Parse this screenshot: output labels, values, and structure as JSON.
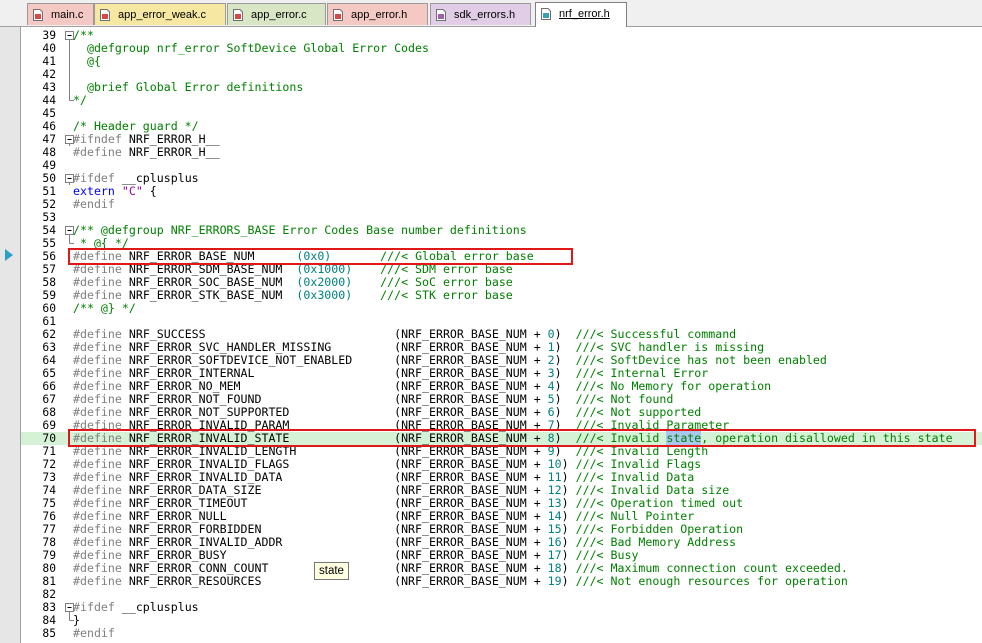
{
  "tabs": [
    {
      "label": "main.c",
      "color": "#f4c9c4",
      "icon": "c-file-icon",
      "icon_color": "#d84848"
    },
    {
      "label": "app_error_weak.c",
      "color": "#f6e7a2",
      "icon": "c-file-gear-icon",
      "icon_color": "#d84848"
    },
    {
      "label": "app_error.c",
      "color": "#d8e6c6",
      "icon": "c-file-gear-icon",
      "icon_color": "#d84848"
    },
    {
      "label": "app_error.h",
      "color": "#f4c9c4",
      "icon": "h-file-icon",
      "icon_color": "#d84848"
    },
    {
      "label": "sdk_errors.h",
      "color": "#e1cde6",
      "icon": "h-file-icon",
      "icon_color": "#a060b0"
    },
    {
      "label": "nrf_error.h",
      "color": "#ffffff",
      "icon": "h-file-icon",
      "icon_color": "#3aa0b8",
      "active": true
    }
  ],
  "tooltip": "state",
  "colors": {
    "comment": "#008000",
    "preprocessor": "#808080",
    "keyword": "#0000ff",
    "number": "#008080",
    "string": "#a000a0",
    "highlight_box": "#e01818"
  },
  "lines": [
    {
      "n": "39",
      "fold": "minus",
      "parts": [
        {
          "t": "/**",
          "c": "c"
        }
      ]
    },
    {
      "n": "40",
      "fold": "bar",
      "parts": [
        {
          "t": "  @defgroup nrf_error SoftDevice Global Error Codes",
          "c": "c"
        }
      ]
    },
    {
      "n": "41",
      "fold": "bar",
      "parts": [
        {
          "t": "  @{",
          "c": "c"
        }
      ]
    },
    {
      "n": "42",
      "fold": "bar",
      "parts": []
    },
    {
      "n": "43",
      "fold": "bar",
      "parts": [
        {
          "t": "  @brief Global Error definitions",
          "c": "c"
        }
      ]
    },
    {
      "n": "44",
      "fold": "end",
      "parts": [
        {
          "t": "*/",
          "c": "c"
        }
      ]
    },
    {
      "n": "45",
      "parts": []
    },
    {
      "n": "46",
      "parts": [
        {
          "t": "/* Header guard */",
          "c": "c"
        }
      ]
    },
    {
      "n": "47",
      "fold": "minus",
      "parts": [
        {
          "t": "#ifndef",
          "c": "p"
        },
        {
          "t": " NRF_ERROR_H__",
          "c": ""
        }
      ]
    },
    {
      "n": "48",
      "parts": [
        {
          "t": "#define",
          "c": "p"
        },
        {
          "t": " NRF_ERROR_H__",
          "c": ""
        }
      ]
    },
    {
      "n": "49",
      "parts": []
    },
    {
      "n": "50",
      "fold": "minus",
      "parts": [
        {
          "t": "#ifdef",
          "c": "p"
        },
        {
          "t": " __cplusplus",
          "c": ""
        }
      ]
    },
    {
      "n": "51",
      "parts": [
        {
          "t": "extern",
          "c": "kw"
        },
        {
          "t": " ",
          "c": ""
        },
        {
          "t": "\"C\"",
          "c": "s"
        },
        {
          "t": " {",
          "c": ""
        }
      ]
    },
    {
      "n": "52",
      "parts": [
        {
          "t": "#endif",
          "c": "p"
        }
      ]
    },
    {
      "n": "53",
      "parts": []
    },
    {
      "n": "54",
      "fold": "minus",
      "parts": [
        {
          "t": "/** @defgroup NRF_ERRORS_BASE Error Codes Base number definitions",
          "c": "c"
        }
      ]
    },
    {
      "n": "55",
      "fold": "end",
      "parts": [
        {
          "t": " * @{ */",
          "c": "c"
        }
      ]
    },
    {
      "n": "56",
      "parts": [
        {
          "t": "#define",
          "c": "p"
        },
        {
          "t": " NRF_ERROR_BASE_NUM      ",
          "c": ""
        },
        {
          "t": "(0x0)",
          "c": "n"
        },
        {
          "t": "       ",
          "c": ""
        },
        {
          "t": "///< Global error base",
          "c": "c"
        }
      ]
    },
    {
      "n": "57",
      "parts": [
        {
          "t": "#define",
          "c": "p"
        },
        {
          "t": " NRF_ERROR_SDM_BASE_NUM  ",
          "c": ""
        },
        {
          "t": "(0x1000)",
          "c": "n"
        },
        {
          "t": "    ",
          "c": ""
        },
        {
          "t": "///< SDM error base",
          "c": "c"
        }
      ]
    },
    {
      "n": "58",
      "parts": [
        {
          "t": "#define",
          "c": "p"
        },
        {
          "t": " NRF_ERROR_SOC_BASE_NUM  ",
          "c": ""
        },
        {
          "t": "(0x2000)",
          "c": "n"
        },
        {
          "t": "    ",
          "c": ""
        },
        {
          "t": "///< SoC error base",
          "c": "c"
        }
      ]
    },
    {
      "n": "59",
      "parts": [
        {
          "t": "#define",
          "c": "p"
        },
        {
          "t": " NRF_ERROR_STK_BASE_NUM  ",
          "c": ""
        },
        {
          "t": "(0x3000)",
          "c": "n"
        },
        {
          "t": "    ",
          "c": ""
        },
        {
          "t": "///< STK error base",
          "c": "c"
        }
      ]
    },
    {
      "n": "60",
      "parts": [
        {
          "t": "/** @} */",
          "c": "c"
        }
      ]
    },
    {
      "n": "61",
      "parts": []
    },
    {
      "n": "62",
      "parts": [
        {
          "t": "#define",
          "c": "p"
        },
        {
          "t": " NRF_SUCCESS                           (NRF_ERROR_BASE_NUM + ",
          "c": ""
        },
        {
          "t": "0",
          "c": "n"
        },
        {
          "t": ")  ",
          "c": ""
        },
        {
          "t": "///< Successful command",
          "c": "c"
        }
      ]
    },
    {
      "n": "63",
      "parts": [
        {
          "t": "#define",
          "c": "p"
        },
        {
          "t": " NRF_ERROR_SVC_HANDLER_MISSING         (NRF_ERROR_BASE_NUM + ",
          "c": ""
        },
        {
          "t": "1",
          "c": "n"
        },
        {
          "t": ")  ",
          "c": ""
        },
        {
          "t": "///< SVC handler is missing",
          "c": "c"
        }
      ]
    },
    {
      "n": "64",
      "parts": [
        {
          "t": "#define",
          "c": "p"
        },
        {
          "t": " NRF_ERROR_SOFTDEVICE_NOT_ENABLED      (NRF_ERROR_BASE_NUM + ",
          "c": ""
        },
        {
          "t": "2",
          "c": "n"
        },
        {
          "t": ")  ",
          "c": ""
        },
        {
          "t": "///< SoftDevice has not been enabled",
          "c": "c"
        }
      ]
    },
    {
      "n": "65",
      "parts": [
        {
          "t": "#define",
          "c": "p"
        },
        {
          "t": " NRF_ERROR_INTERNAL                    (NRF_ERROR_BASE_NUM + ",
          "c": ""
        },
        {
          "t": "3",
          "c": "n"
        },
        {
          "t": ")  ",
          "c": ""
        },
        {
          "t": "///< Internal Error",
          "c": "c"
        }
      ]
    },
    {
      "n": "66",
      "parts": [
        {
          "t": "#define",
          "c": "p"
        },
        {
          "t": " NRF_ERROR_NO_MEM                      (NRF_ERROR_BASE_NUM + ",
          "c": ""
        },
        {
          "t": "4",
          "c": "n"
        },
        {
          "t": ")  ",
          "c": ""
        },
        {
          "t": "///< No Memory for operation",
          "c": "c"
        }
      ]
    },
    {
      "n": "67",
      "parts": [
        {
          "t": "#define",
          "c": "p"
        },
        {
          "t": " NRF_ERROR_NOT_FOUND                   (NRF_ERROR_BASE_NUM + ",
          "c": ""
        },
        {
          "t": "5",
          "c": "n"
        },
        {
          "t": ")  ",
          "c": ""
        },
        {
          "t": "///< Not found",
          "c": "c"
        }
      ]
    },
    {
      "n": "68",
      "parts": [
        {
          "t": "#define",
          "c": "p"
        },
        {
          "t": " NRF_ERROR_NOT_SUPPORTED               (NRF_ERROR_BASE_NUM + ",
          "c": ""
        },
        {
          "t": "6",
          "c": "n"
        },
        {
          "t": ")  ",
          "c": ""
        },
        {
          "t": "///< Not supported",
          "c": "c"
        }
      ]
    },
    {
      "n": "69",
      "parts": [
        {
          "t": "#define",
          "c": "p"
        },
        {
          "t": " NRF_ERROR_INVALID_PARAM               (NRF_ERROR_BASE_NUM + ",
          "c": ""
        },
        {
          "t": "7",
          "c": "n"
        },
        {
          "t": ")  ",
          "c": ""
        },
        {
          "t": "///< Invalid Parameter",
          "c": "c"
        }
      ]
    },
    {
      "n": "70",
      "hl": true,
      "parts": [
        {
          "t": "#define",
          "c": "p"
        },
        {
          "t": " NRF_ERROR_INVALID_STATE               (NRF_ERROR_BASE_NUM + ",
          "c": ""
        },
        {
          "t": "8",
          "c": "n"
        },
        {
          "t": ")  ",
          "c": ""
        },
        {
          "t": "///< Invalid ",
          "c": "c"
        },
        {
          "t": "state",
          "c": "c sel"
        },
        {
          "t": ", operation disallowed in this state",
          "c": "c"
        }
      ]
    },
    {
      "n": "71",
      "parts": [
        {
          "t": "#define",
          "c": "p"
        },
        {
          "t": " NRF_ERROR_INVALID_LENGTH              (NRF_ERROR_BASE_NUM + ",
          "c": ""
        },
        {
          "t": "9",
          "c": "n"
        },
        {
          "t": ")  ",
          "c": ""
        },
        {
          "t": "///< Invalid Length",
          "c": "c"
        }
      ]
    },
    {
      "n": "72",
      "parts": [
        {
          "t": "#define",
          "c": "p"
        },
        {
          "t": " NRF_ERROR_INVALID_FLAGS               (NRF_ERROR_BASE_NUM + ",
          "c": ""
        },
        {
          "t": "10",
          "c": "n"
        },
        {
          "t": ") ",
          "c": ""
        },
        {
          "t": "///< Invalid Flags",
          "c": "c"
        }
      ]
    },
    {
      "n": "73",
      "parts": [
        {
          "t": "#define",
          "c": "p"
        },
        {
          "t": " NRF_ERROR_INVALID_DATA                (NRF_ERROR_BASE_NUM + ",
          "c": ""
        },
        {
          "t": "11",
          "c": "n"
        },
        {
          "t": ") ",
          "c": ""
        },
        {
          "t": "///< Invalid Data",
          "c": "c"
        }
      ]
    },
    {
      "n": "74",
      "parts": [
        {
          "t": "#define",
          "c": "p"
        },
        {
          "t": " NRF_ERROR_DATA_SIZE                   (NRF_ERROR_BASE_NUM + ",
          "c": ""
        },
        {
          "t": "12",
          "c": "n"
        },
        {
          "t": ") ",
          "c": ""
        },
        {
          "t": "///< Invalid Data size",
          "c": "c"
        }
      ]
    },
    {
      "n": "75",
      "parts": [
        {
          "t": "#define",
          "c": "p"
        },
        {
          "t": " NRF_ERROR_TIMEOUT                     (NRF_ERROR_BASE_NUM + ",
          "c": ""
        },
        {
          "t": "13",
          "c": "n"
        },
        {
          "t": ") ",
          "c": ""
        },
        {
          "t": "///< Operation timed out",
          "c": "c"
        }
      ]
    },
    {
      "n": "76",
      "parts": [
        {
          "t": "#define",
          "c": "p"
        },
        {
          "t": " NRF_ERROR_NULL                        (NRF_ERROR_BASE_NUM + ",
          "c": ""
        },
        {
          "t": "14",
          "c": "n"
        },
        {
          "t": ") ",
          "c": ""
        },
        {
          "t": "///< Null Pointer",
          "c": "c"
        }
      ]
    },
    {
      "n": "77",
      "parts": [
        {
          "t": "#define",
          "c": "p"
        },
        {
          "t": " NRF_ERROR_FORBIDDEN                   (NRF_ERROR_BASE_NUM + ",
          "c": ""
        },
        {
          "t": "15",
          "c": "n"
        },
        {
          "t": ") ",
          "c": ""
        },
        {
          "t": "///< Forbidden Operation",
          "c": "c"
        }
      ]
    },
    {
      "n": "78",
      "parts": [
        {
          "t": "#define",
          "c": "p"
        },
        {
          "t": " NRF_ERROR_INVALID_ADDR                (NRF_ERROR_BASE_NUM + ",
          "c": ""
        },
        {
          "t": "16",
          "c": "n"
        },
        {
          "t": ") ",
          "c": ""
        },
        {
          "t": "///< Bad Memory Address",
          "c": "c"
        }
      ]
    },
    {
      "n": "79",
      "parts": [
        {
          "t": "#define",
          "c": "p"
        },
        {
          "t": " NRF_ERROR_BUSY                        (NRF_ERROR_BASE_NUM + ",
          "c": ""
        },
        {
          "t": "17",
          "c": "n"
        },
        {
          "t": ") ",
          "c": ""
        },
        {
          "t": "///< Busy",
          "c": "c"
        }
      ]
    },
    {
      "n": "80",
      "parts": [
        {
          "t": "#define",
          "c": "p"
        },
        {
          "t": " NRF_ERROR_CONN_COUNT                  (NRF_ERROR_BASE_NUM + ",
          "c": ""
        },
        {
          "t": "18",
          "c": "n"
        },
        {
          "t": ") ",
          "c": ""
        },
        {
          "t": "///< Maximum connection count exceeded.",
          "c": "c"
        }
      ]
    },
    {
      "n": "81",
      "parts": [
        {
          "t": "#define",
          "c": "p"
        },
        {
          "t": " NRF_ERROR_RESOURCES                   (NRF_ERROR_BASE_NUM + ",
          "c": ""
        },
        {
          "t": "19",
          "c": "n"
        },
        {
          "t": ") ",
          "c": ""
        },
        {
          "t": "///< Not enough resources for operation",
          "c": "c"
        }
      ]
    },
    {
      "n": "82",
      "parts": []
    },
    {
      "n": "83",
      "fold": "minus",
      "parts": [
        {
          "t": "#ifdef",
          "c": "p"
        },
        {
          "t": " __cplusplus",
          "c": ""
        }
      ]
    },
    {
      "n": "84",
      "fold": "end",
      "parts": [
        {
          "t": "}",
          "c": ""
        }
      ]
    },
    {
      "n": "85",
      "parts": [
        {
          "t": "#endif",
          "c": "p"
        }
      ]
    }
  ]
}
